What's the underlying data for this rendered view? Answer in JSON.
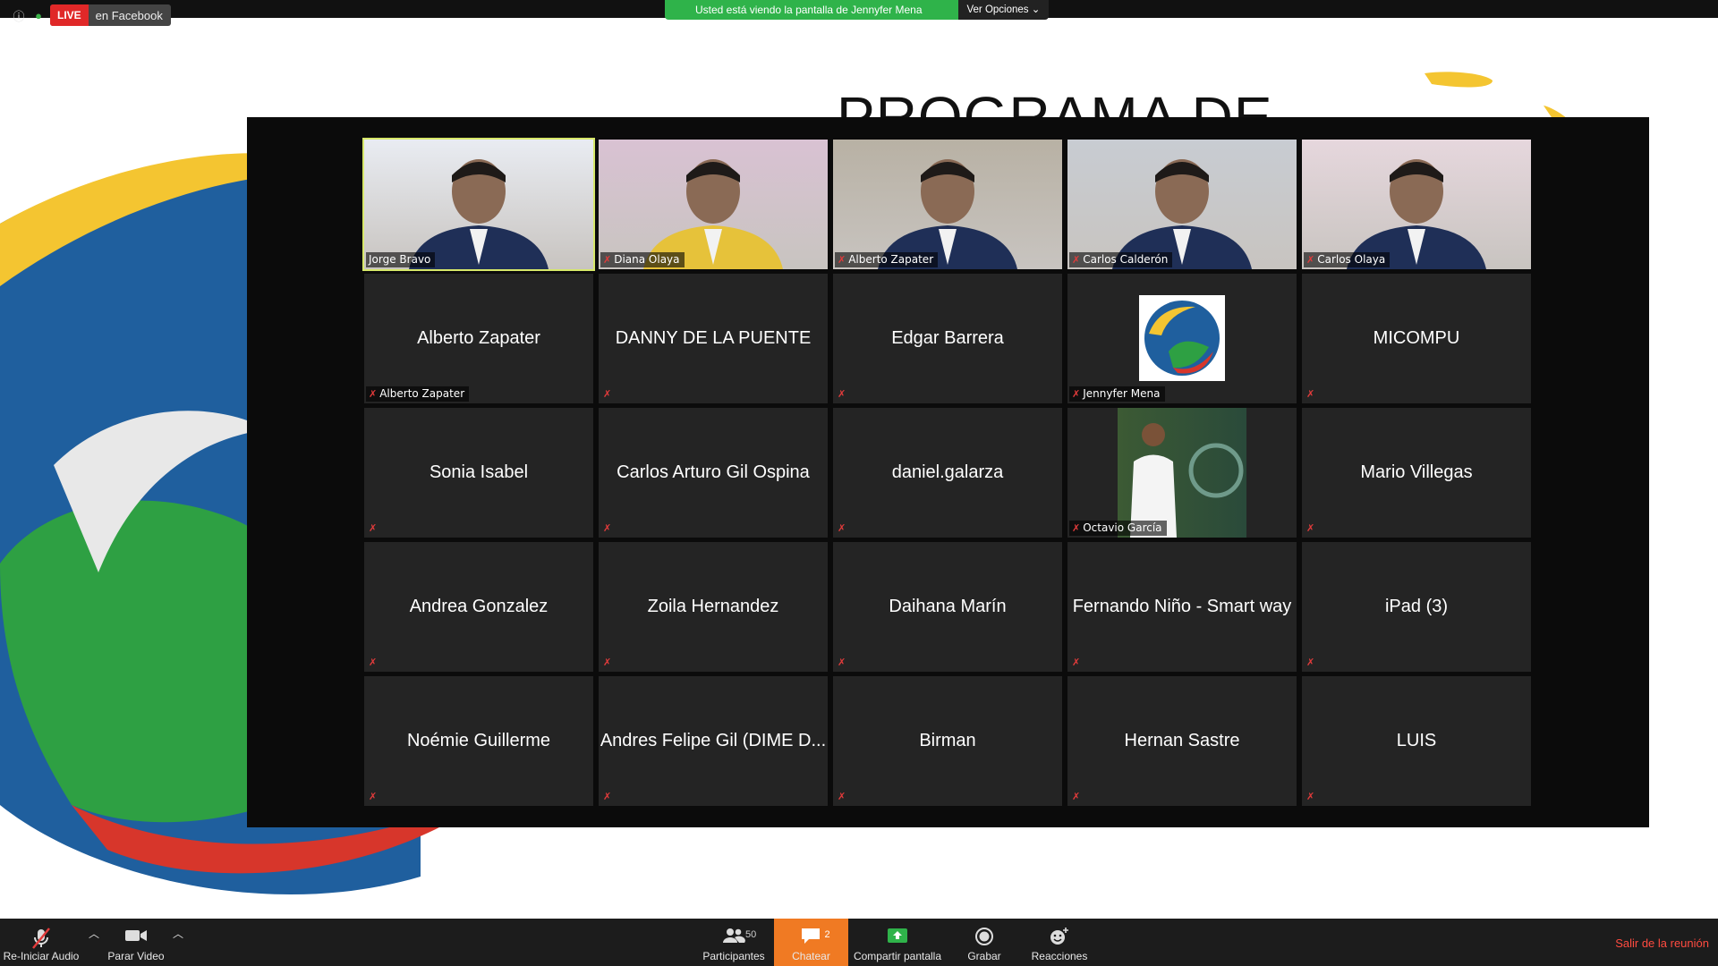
{
  "topbar": {
    "live_label": "LIVE",
    "live_platform": "en Facebook",
    "share_message": "Usted está viendo la pantalla de Jennyfer Mena",
    "view_options": "Ver Opciones"
  },
  "slide": {
    "title": "PROGRAMA DE"
  },
  "gallery": {
    "tiles": [
      {
        "display": "",
        "label": "Jorge Bravo",
        "video": true
      },
      {
        "display": "",
        "label": "Diana Olaya",
        "video": true
      },
      {
        "display": "",
        "label": "Alberto Zapater",
        "video": true
      },
      {
        "display": "",
        "label": "Carlos Calderón",
        "video": true
      },
      {
        "display": "",
        "label": "Carlos Olaya",
        "video": true
      },
      {
        "display": "Alberto Zapater",
        "label": "Alberto Zapater"
      },
      {
        "display": "DANNY DE LA PUENTE",
        "label": ""
      },
      {
        "display": "Edgar Barrera",
        "label": ""
      },
      {
        "display": "",
        "label": "Jennyfer Mena",
        "logo": true
      },
      {
        "display": "MICOMPU",
        "label": ""
      },
      {
        "display": "Sonia Isabel",
        "label": ""
      },
      {
        "display": "Carlos Arturo Gil Ospina",
        "label": ""
      },
      {
        "display": "daniel.galarza",
        "label": ""
      },
      {
        "display": "",
        "label": "Octavio García",
        "photo": true
      },
      {
        "display": "Mario Villegas",
        "label": ""
      },
      {
        "display": "Andrea Gonzalez",
        "label": ""
      },
      {
        "display": "Zoila Hernandez",
        "label": ""
      },
      {
        "display": "Daihana Marín",
        "label": ""
      },
      {
        "display": "Fernando Niño - Smart way",
        "label": ""
      },
      {
        "display": "iPad (3)",
        "label": ""
      },
      {
        "display": "Noémie Guillerme",
        "label": ""
      },
      {
        "display": "Andres Felipe Gil (DIME D...",
        "label": ""
      },
      {
        "display": "Birman",
        "label": ""
      },
      {
        "display": "Hernan Sastre",
        "label": ""
      },
      {
        "display": "LUIS",
        "label": ""
      }
    ]
  },
  "toolbar": {
    "audio": "Re-Iniciar Audio",
    "video": "Parar Video",
    "participants": "Participantes",
    "participants_count": "50",
    "chat": "Chatear",
    "chat_count": "2",
    "share": "Compartir pantalla",
    "record": "Grabar",
    "reactions": "Reacciones",
    "leave": "Salir de la reunión"
  },
  "colors": {
    "accent_chat": "#f07a23",
    "live_red": "#e02828",
    "banner_green": "#2fb34a",
    "leave_red": "#ff4b40"
  }
}
